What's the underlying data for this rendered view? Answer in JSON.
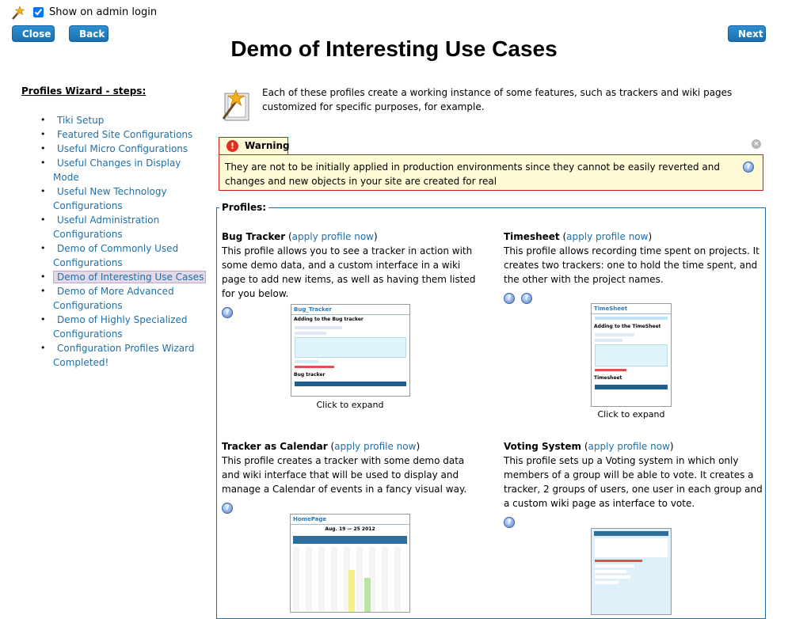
{
  "toolbar": {
    "show_on_admin_login_label": "Show on admin login",
    "close_label": "Close",
    "back_label": "Back",
    "next_label": "Next"
  },
  "page_title": "Demo of Interesting Use Cases",
  "sidebar": {
    "title": "Profiles Wizard - steps:",
    "items": [
      {
        "label": "Tiki Setup"
      },
      {
        "label": "Featured Site Configurations"
      },
      {
        "label": "Useful Micro Configurations"
      },
      {
        "label": "Useful Changes in Display Mode"
      },
      {
        "label": "Useful New Technology Configurations"
      },
      {
        "label": "Useful Administration Configurations"
      },
      {
        "label": "Demo of Commonly Used Configurations"
      },
      {
        "label": "Demo of Interesting Use Cases"
      },
      {
        "label": "Demo of More Advanced Configurations"
      },
      {
        "label": "Demo of Highly Specialized Configurations"
      },
      {
        "label": "Configuration Profiles Wizard Completed!"
      }
    ]
  },
  "intro": {
    "text": "Each of these profiles create a working instance of some features, such as trackers and wiki pages customized for specific purposes, for example."
  },
  "warning": {
    "title": "Warning",
    "text": "They are not to be initially applied in production environments since they cannot be easily reverted and changes and new objects in your site are created for real"
  },
  "profiles": {
    "legend": "Profiles:",
    "apply_link": "apply profile now",
    "click_to_expand": "Click to expand",
    "items": [
      {
        "name": "Bug Tracker",
        "description": "This profile allows you to see a tracker in action with some demo data, and a custom interface in a wiki page to add new items, as well as having them listed for you below.",
        "thumb_title": "Bug_Tracker",
        "thumb_heading": "Adding to the Bug tracker",
        "thumb_subheading": "Bug tracker"
      },
      {
        "name": "Timesheet",
        "description": "This profile allows recording time spent on projects. It creates two trackers: one to hold the time spent, and the other with the project names.",
        "thumb_title": "TimeSheet",
        "thumb_heading": "Adding to the TimeSheet",
        "thumb_subheading": "Timesheet"
      },
      {
        "name": "Tracker as Calendar",
        "description": "This profile creates a tracker with some demo data and wiki interface that will be used to display and manage a Calendar of events in a fancy visual way.",
        "thumb_title": "HomePage",
        "thumb_heading": "Aug. 19 — 25 2012"
      },
      {
        "name": "Voting System",
        "description": "This profile sets up a Voting system in which only members of a group will be able to vote. It creates a tracker, 2 groups of users, one user in each group and a custom wiki page as interface to vote."
      }
    ]
  }
}
